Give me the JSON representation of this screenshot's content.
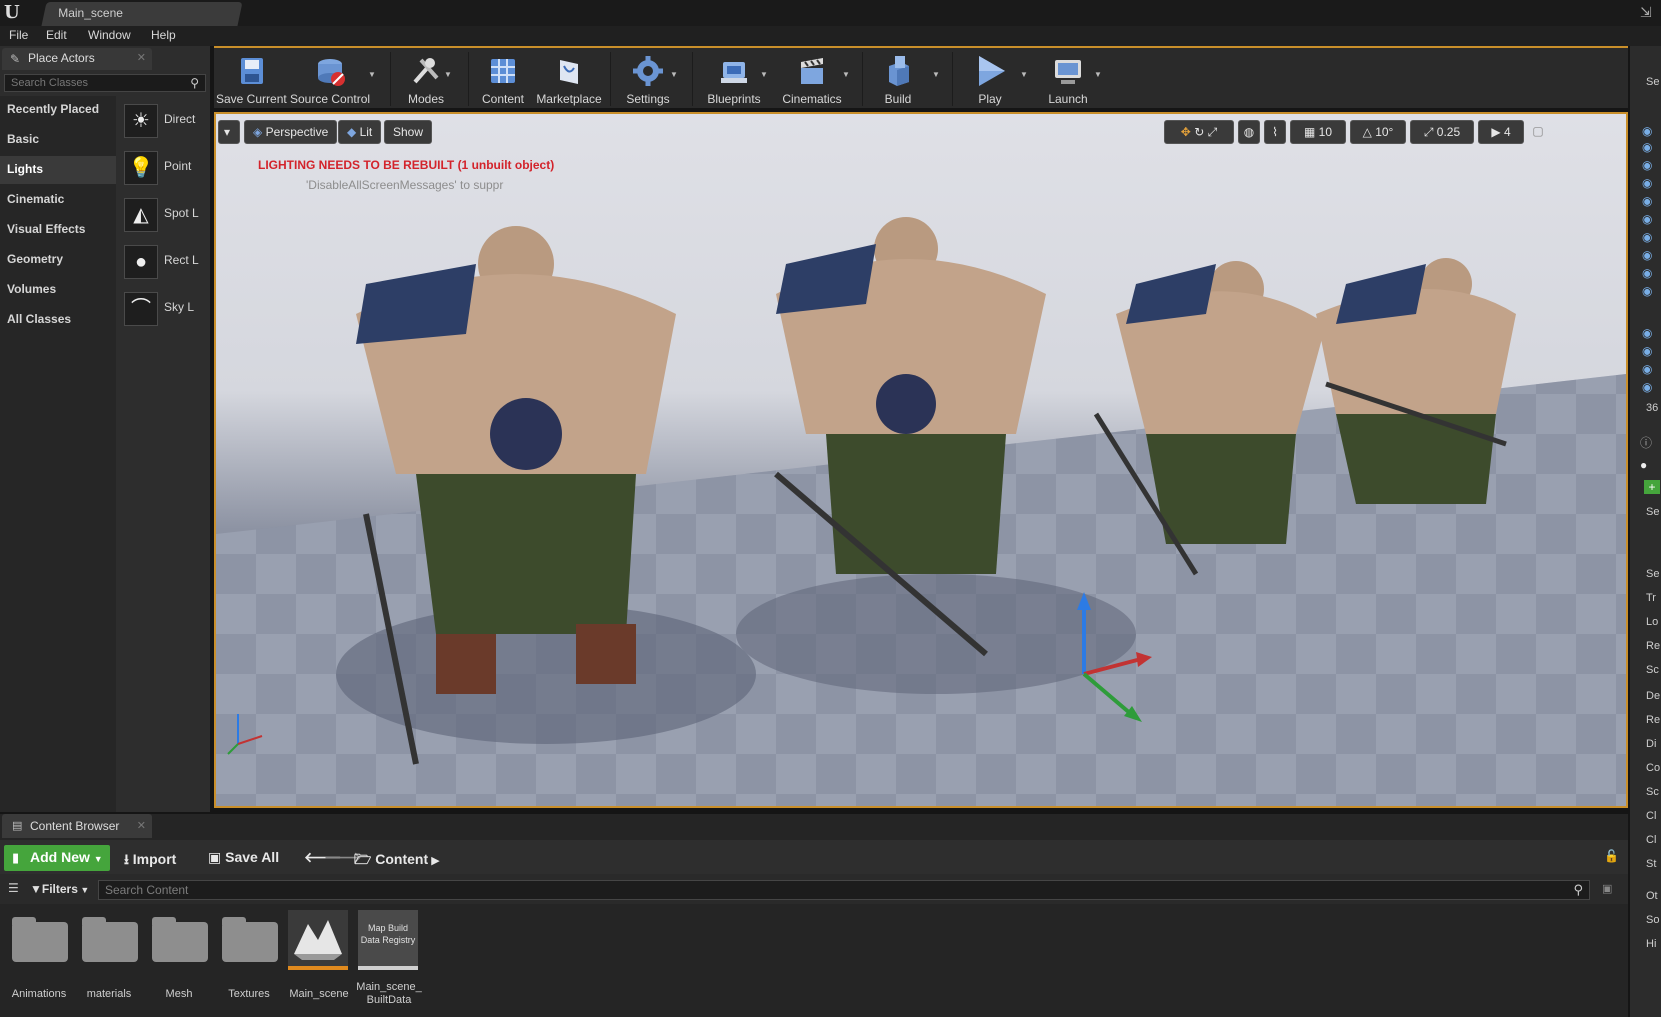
{
  "window": {
    "tab_title": "Main_scene",
    "logo_icon": "unreal-logo-icon"
  },
  "menu": [
    "File",
    "Edit",
    "Window",
    "Help"
  ],
  "place_actors": {
    "tab_label": "Place Actors",
    "search_placeholder": "Search Classes",
    "categories": [
      "Recently Placed",
      "Basic",
      "Lights",
      "Cinematic",
      "Visual Effects",
      "Geometry",
      "Volumes",
      "All Classes"
    ],
    "active_category": "Lights",
    "items": [
      {
        "label": "Direct",
        "icon": "directional-light-icon"
      },
      {
        "label": "Point",
        "icon": "point-light-icon"
      },
      {
        "label": "Spot L",
        "icon": "spot-light-icon"
      },
      {
        "label": "Rect L",
        "icon": "rect-light-icon"
      },
      {
        "label": "Sky L",
        "icon": "sky-light-icon"
      }
    ]
  },
  "toolbar": {
    "items": [
      {
        "label": "Save Current",
        "icon": "save-icon"
      },
      {
        "label": "Source Control",
        "icon": "source-control-icon"
      },
      {
        "label": "Modes",
        "icon": "modes-icon"
      },
      {
        "label": "Content",
        "icon": "content-icon"
      },
      {
        "label": "Marketplace",
        "icon": "marketplace-icon"
      },
      {
        "label": "Settings",
        "icon": "settings-icon"
      },
      {
        "label": "Blueprints",
        "icon": "blueprints-icon"
      },
      {
        "label": "Cinematics",
        "icon": "cinematics-icon"
      },
      {
        "label": "Build",
        "icon": "build-icon"
      },
      {
        "label": "Play",
        "icon": "play-icon"
      },
      {
        "label": "Launch",
        "icon": "launch-icon"
      }
    ]
  },
  "viewport": {
    "perspective_label": "Perspective",
    "lit_label": "Lit",
    "show_label": "Show",
    "warning": "LIGHTING NEEDS TO BE REBUILT (1 unbuilt object)",
    "note": "'DisableAllScreenMessages' to suppr",
    "grid_snap": "10",
    "rotation_snap": "10°",
    "scale_snap": "0.25",
    "camera_speed": "4"
  },
  "right_strip": {
    "truncated_number": "36",
    "search_stub": "Se",
    "section_stubs": [
      "Tr",
      "Lo",
      "Re",
      "Sc",
      "De",
      "Re",
      "Di",
      "Co",
      "Sc",
      "Cl",
      "Cl",
      "St",
      "Ot",
      "So",
      "Hi"
    ]
  },
  "content_browser": {
    "tab_label": "Content Browser",
    "add_new_label": "Add New",
    "import_label": "Import",
    "save_all_label": "Save All",
    "path_label": "Content",
    "filters_label": "Filters",
    "search_placeholder": "Search Content",
    "assets": [
      {
        "label": "Animations",
        "type": "folder"
      },
      {
        "label": "materials",
        "type": "folder"
      },
      {
        "label": "Mesh",
        "type": "folder"
      },
      {
        "label": "Textures",
        "type": "folder"
      },
      {
        "label": "Main_scene",
        "type": "level"
      },
      {
        "label": "Main_scene_\nBuiltData",
        "type": "registry",
        "thumb_text": "Map Build Data Registry"
      }
    ]
  },
  "colors": {
    "accent_orange": "#c98f2a",
    "add_new_green": "#45a53c",
    "warning_red": "#d3232b",
    "eye_blue": "#79aee6"
  }
}
